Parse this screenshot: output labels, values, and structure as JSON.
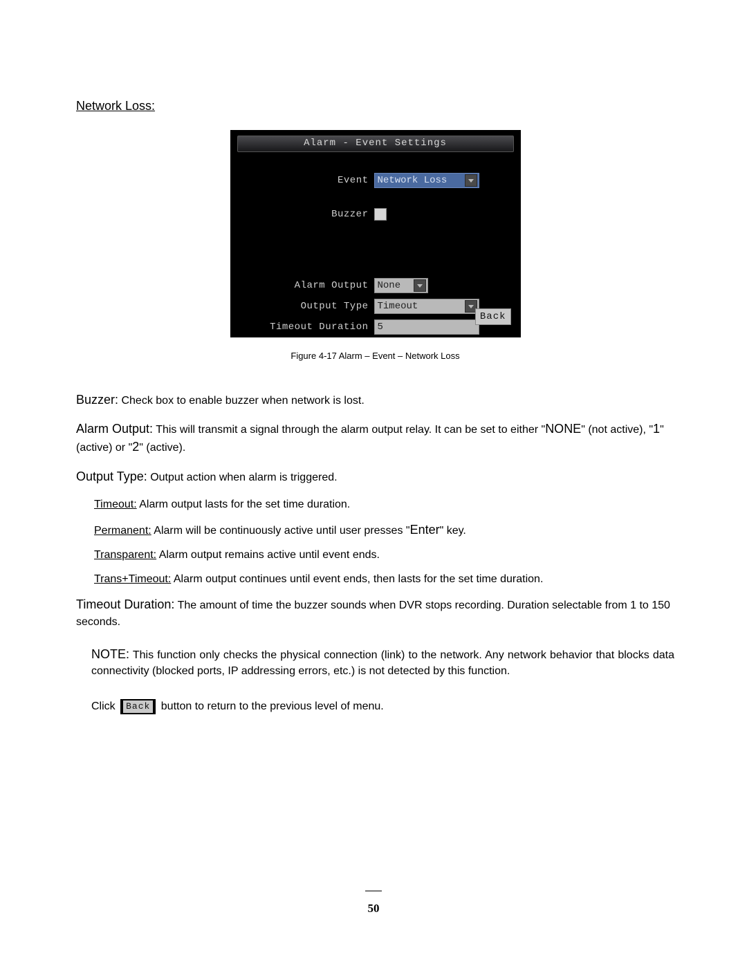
{
  "heading": "Network Loss:",
  "dvr": {
    "title": "Alarm - Event Settings",
    "fields": {
      "event_label": "Event",
      "event_value": "Network Loss",
      "buzzer_label": "Buzzer",
      "alarm_output_label": "Alarm Output",
      "alarm_output_value": "None",
      "output_type_label": "Output Type",
      "output_type_value": "Timeout",
      "timeout_duration_label": "Timeout Duration",
      "timeout_duration_value": "5"
    },
    "back_label": "Back"
  },
  "caption": "Figure 4-17 Alarm – Event – Network Loss",
  "body": {
    "buzzer_term": "Buzzer:",
    "buzzer_text": " Check box to enable buzzer when network is lost.",
    "alarm_output_term": "Alarm Output:",
    "alarm_output_text_1": " This will transmit a signal through the alarm output relay. It can be set to either \"",
    "alarm_output_none": "NONE",
    "alarm_output_text_2": "\" (not active), \"",
    "alarm_output_one": "1",
    "alarm_output_text_3": "\" (active) or \"",
    "alarm_output_two": "2",
    "alarm_output_text_4": "\" (active).",
    "output_type_term": "Output Type:",
    "output_type_text": " Output action when alarm is triggered.",
    "opt_timeout_term": "Timeout:",
    "opt_timeout_text": " Alarm output lasts for the set time duration.",
    "opt_permanent_term": "Permanent:",
    "opt_permanent_text_1": " Alarm will be continuously active until user presses \"",
    "opt_permanent_enter": "Enter",
    "opt_permanent_text_2": "\" key.",
    "opt_transparent_term": "Transparent:",
    "opt_transparent_text": " Alarm output remains active until event ends.",
    "opt_trans_timeout_term": "Trans+Timeout:",
    "opt_trans_timeout_text": " Alarm output continues until event ends, then lasts for the set time duration.",
    "timeout_duration_term": "Timeout Duration:",
    "timeout_duration_text": " The amount of time the buzzer sounds when DVR stops recording. Duration selectable from 1 to 150 seconds.",
    "note_term": "NOTE:",
    "note_text": " This function only checks the physical connection (link) to the network. Any network behavior that blocks data connectivity (blocked ports, IP addressing errors, etc.) is not detected by this function.",
    "click_text_1": "Click ",
    "click_back_label": "Back",
    "click_text_2": " button to return to the previous level of menu."
  },
  "page_number": "50"
}
